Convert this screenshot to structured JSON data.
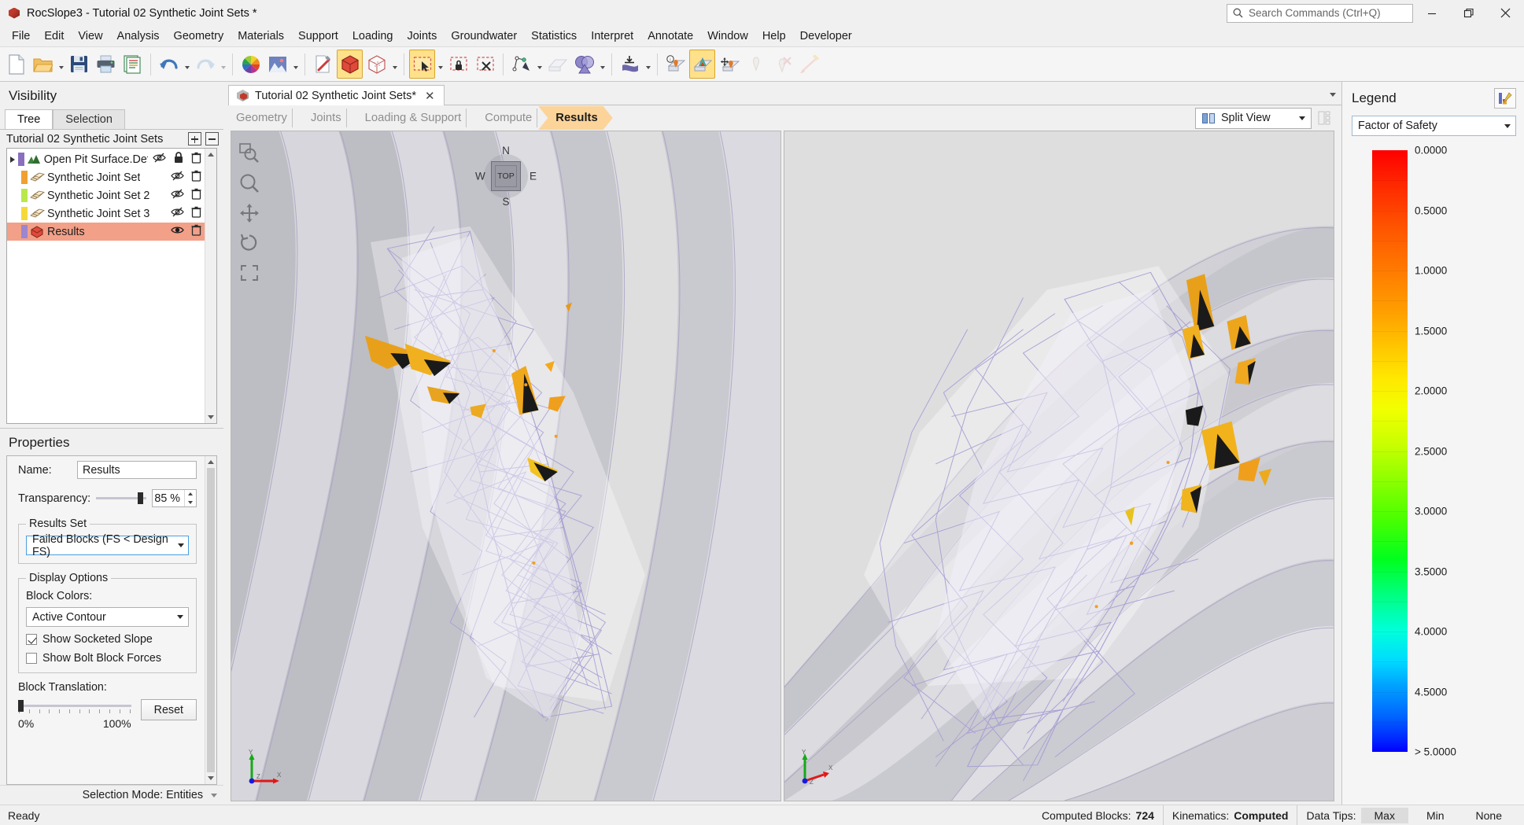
{
  "window": {
    "app_name": "RocSlope3",
    "title": "RocSlope3 - Tutorial 02 Synthetic Joint Sets *",
    "minimize_label": "—",
    "maximize_label": "❐",
    "close_label": "✕"
  },
  "search": {
    "placeholder": "Search Commands (Ctrl+Q)",
    "value": ""
  },
  "menubar": {
    "items": [
      "File",
      "Edit",
      "View",
      "Analysis",
      "Geometry",
      "Materials",
      "Support",
      "Loading",
      "Joints",
      "Groundwater",
      "Statistics",
      "Interpret",
      "Annotate",
      "Window",
      "Help",
      "Developer"
    ]
  },
  "toolbar": {
    "groups": [
      {
        "buttons": [
          {
            "name": "new-file-icon",
            "state": "normal",
            "dropdown": false
          },
          {
            "name": "open-folder-icon",
            "state": "normal",
            "dropdown": true
          },
          {
            "name": "save-icon",
            "state": "normal",
            "dropdown": false
          },
          {
            "name": "print-icon",
            "state": "normal",
            "dropdown": false
          },
          {
            "name": "report-icon",
            "state": "normal",
            "dropdown": false
          }
        ]
      },
      {
        "buttons": [
          {
            "name": "undo-icon",
            "state": "normal",
            "dropdown": true
          },
          {
            "name": "redo-icon",
            "state": "disabled",
            "dropdown": true
          }
        ]
      },
      {
        "buttons": [
          {
            "name": "color-wheel-icon",
            "state": "normal",
            "dropdown": false
          },
          {
            "name": "image-capture-icon",
            "state": "normal",
            "dropdown": true
          }
        ]
      },
      {
        "buttons": [
          {
            "name": "edit-properties-icon",
            "state": "normal",
            "dropdown": false
          },
          {
            "name": "solid-block-icon",
            "state": "active",
            "dropdown": false
          },
          {
            "name": "wireframe-block-icon",
            "state": "normal",
            "dropdown": true
          }
        ]
      },
      {
        "buttons": [
          {
            "name": "select-entities-icon",
            "state": "active",
            "dropdown": true
          },
          {
            "name": "lock-selection-icon",
            "state": "normal",
            "dropdown": false
          },
          {
            "name": "clear-selection-icon",
            "state": "normal",
            "dropdown": false
          }
        ]
      },
      {
        "buttons": [
          {
            "name": "draw-polyline-icon",
            "state": "normal",
            "dropdown": true
          },
          {
            "name": "surface-icon",
            "state": "disabled",
            "dropdown": false
          },
          {
            "name": "boolean-icon",
            "state": "normal",
            "dropdown": true
          }
        ]
      },
      {
        "buttons": [
          {
            "name": "import-surface-icon",
            "state": "normal",
            "dropdown": true
          }
        ]
      },
      {
        "buttons": [
          {
            "name": "block-info-icon",
            "state": "normal",
            "dropdown": false
          },
          {
            "name": "contour-blocks-icon",
            "state": "active",
            "dropdown": false
          },
          {
            "name": "translate-block-icon",
            "state": "normal",
            "dropdown": false
          },
          {
            "name": "show-block-icon",
            "state": "disabled",
            "dropdown": false
          },
          {
            "name": "hide-block-icon",
            "state": "disabled",
            "dropdown": false
          },
          {
            "name": "bolt-icon",
            "state": "disabled",
            "dropdown": false
          }
        ]
      }
    ]
  },
  "visibility": {
    "panel_title": "Visibility",
    "tabs": [
      {
        "label": "Tree",
        "selected": true
      },
      {
        "label": "Selection",
        "selected": false
      }
    ],
    "tree_root_label": "Tutorial 02 Synthetic Joint Sets",
    "expand_all_tooltip": "Expand All",
    "collapse_all_tooltip": "Collapse All",
    "items": [
      {
        "label": "Open Pit Surface.Default.M",
        "swatch": "#8a6fc0",
        "icon": "terrain-icon",
        "expandable": true,
        "visible": false,
        "locked": true,
        "selected": false
      },
      {
        "label": "Synthetic Joint Set",
        "swatch": "#f0a030",
        "icon": "joint-set-icon",
        "expandable": false,
        "visible": false,
        "locked": false,
        "selected": false
      },
      {
        "label": "Synthetic Joint Set 2",
        "swatch": "#b9e84a",
        "icon": "joint-set-icon",
        "expandable": false,
        "visible": false,
        "locked": false,
        "selected": false
      },
      {
        "label": "Synthetic Joint Set 3",
        "swatch": "#f5d93a",
        "icon": "joint-set-icon",
        "expandable": false,
        "visible": false,
        "locked": false,
        "selected": false
      },
      {
        "label": "Results",
        "swatch": "#9b86cf",
        "icon": "results-icon",
        "expandable": false,
        "visible": true,
        "locked": false,
        "selected": true
      }
    ]
  },
  "properties": {
    "panel_title": "Properties",
    "name_label": "Name:",
    "name_value": "Results",
    "transparency_label": "Transparency:",
    "transparency_value": "85 %",
    "transparency_percent": 85,
    "results_set_group": "Results Set",
    "results_set_value": "Failed Blocks (FS < Design FS)",
    "display_options_group": "Display Options",
    "block_colors_label": "Block Colors:",
    "block_colors_value": "Active Contour",
    "show_socketed_slope_label": "Show Socketed Slope",
    "show_socketed_slope_checked": true,
    "show_bolt_block_forces_label": "Show Bolt Block Forces",
    "show_bolt_block_forces_checked": false,
    "block_translation_label": "Block Translation:",
    "block_translation_min": "0%",
    "block_translation_max": "100%",
    "block_translation_percent": 0,
    "reset_label": "Reset",
    "selection_mode_label": "Selection Mode:",
    "selection_mode_value": "Entities"
  },
  "document": {
    "tab_label": "Tutorial 02 Synthetic Joint Sets*",
    "close_label": "✕"
  },
  "workflow": {
    "steps": [
      {
        "label": "Geometry",
        "active": false
      },
      {
        "label": "Joints",
        "active": false
      },
      {
        "label": "Loading & Support",
        "active": false
      },
      {
        "label": "Compute",
        "active": false
      },
      {
        "label": "Results",
        "active": true
      }
    ]
  },
  "view_controls": {
    "split_view_label": "Split View",
    "tools": [
      {
        "name": "zoom-window-icon",
        "label": "Zoom Window"
      },
      {
        "name": "zoom-icon",
        "label": "Zoom"
      },
      {
        "name": "pan-icon",
        "label": "Pan"
      },
      {
        "name": "rotate-icon",
        "label": "Rotate"
      },
      {
        "name": "zoom-all-icon",
        "label": "Zoom All"
      }
    ]
  },
  "compass": {
    "north": "N",
    "south": "S",
    "east": "E",
    "west": "W",
    "face": "TOP"
  },
  "axes": {
    "x": "X",
    "y": "Y",
    "z": "Z"
  },
  "legend": {
    "panel_title": "Legend",
    "options_tooltip": "Legend Options",
    "contour_value": "Factor of Safety",
    "ticks": [
      {
        "value": "0.0000",
        "pos": 0
      },
      {
        "value": "0.5000",
        "pos": 10
      },
      {
        "value": "1.0000",
        "pos": 20
      },
      {
        "value": "1.5000",
        "pos": 30
      },
      {
        "value": "2.0000",
        "pos": 40
      },
      {
        "value": "2.5000",
        "pos": 50
      },
      {
        "value": "3.0000",
        "pos": 60
      },
      {
        "value": "3.5000",
        "pos": 70
      },
      {
        "value": "4.0000",
        "pos": 80
      },
      {
        "value": "4.5000",
        "pos": 90
      },
      {
        "value": "> 5.0000",
        "pos": 100
      }
    ],
    "colors": {
      "min": "#fe0000",
      "mid": "#00ff1e",
      "max": "#0000fe"
    }
  },
  "statusbar": {
    "ready_text": "Ready",
    "computed_blocks_label": "Computed Blocks:",
    "computed_blocks_value": "724",
    "kinematics_label": "Kinematics:",
    "kinematics_value": "Computed",
    "data_tips_label": "Data Tips:",
    "data_tips_options": [
      {
        "label": "Max",
        "selected": true
      },
      {
        "label": "Min",
        "selected": false
      },
      {
        "label": "None",
        "selected": false
      }
    ]
  }
}
